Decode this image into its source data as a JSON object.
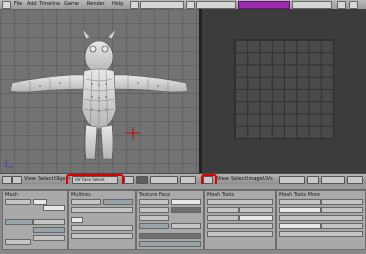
{
  "top_menu": {
    "items": [
      "File",
      "Add",
      "Timeline",
      "Game",
      "Render",
      "Help"
    ]
  },
  "viewport_3d": {
    "mesh": "character-mesh"
  },
  "view3d_header": {
    "buttons": [
      "View",
      "Select",
      "Object"
    ],
    "mode_select": "UV Face Select",
    "highlighted": "mode-selector"
  },
  "uv_header": {
    "buttons": [
      "View",
      "Select",
      "Image",
      "UVs"
    ],
    "highlighted": "uv-editor-icon"
  },
  "properties": {
    "panels": [
      "Mesh",
      "Multires",
      "Texture Face",
      "Mesh Tools",
      "Mesh Tools More"
    ]
  },
  "colors": {
    "highlight": "#e00000",
    "selected_tab": "#9b2bb0",
    "grid_background": "#737373",
    "uv_background": "#3c3c3c"
  }
}
